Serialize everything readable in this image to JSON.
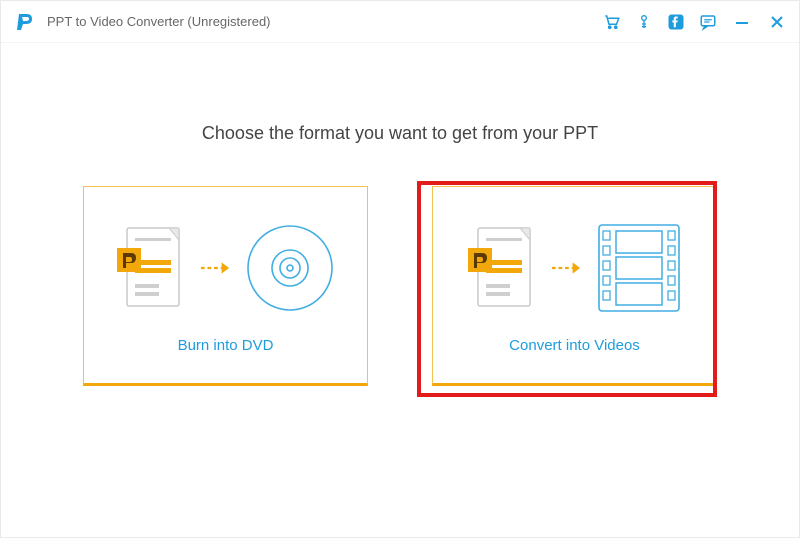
{
  "title": "PPT to Video Converter (Unregistered)",
  "heading": "Choose the format you want to get from your PPT",
  "options": {
    "burn": {
      "label": "Burn into DVD"
    },
    "convert": {
      "label": "Convert into Videos"
    }
  },
  "colors": {
    "accent": "#1e9cdd",
    "gold": "#f2a80a",
    "highlight": "#e21b1b"
  }
}
